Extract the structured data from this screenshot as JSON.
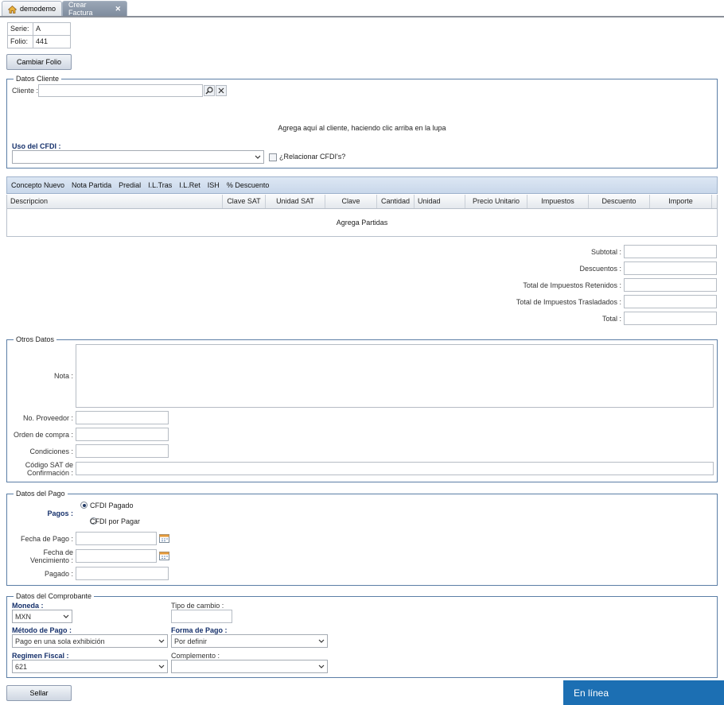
{
  "tabs": [
    {
      "label": "demodemo",
      "icon": "home-icon"
    },
    {
      "label": "Crear Factura",
      "close_icon": "close-icon"
    }
  ],
  "serie_folio": {
    "serie_label": "Serie:",
    "serie_value": "A",
    "folio_label": "Folio:",
    "folio_value": "441"
  },
  "cambiar_folio_label": "Cambiar Folio",
  "datos_cliente": {
    "legend": "Datos Cliente",
    "cliente_label": "Cliente :",
    "cliente_value": "",
    "hint": "Agrega aquí al cliente, haciendo clic arriba en la lupa",
    "uso_cfdi_label": "Uso del CFDI :",
    "uso_cfdi_value": "",
    "relacionar_label": "¿Relacionar CFDI's?"
  },
  "grid": {
    "toolbar": [
      "Concepto Nuevo",
      "Nota Partida",
      "Predial",
      "I.L.Tras",
      "I.L.Ret",
      "ISH",
      "% Descuento"
    ],
    "columns": [
      "Descripcion",
      "Clave SAT",
      "Unidad SAT",
      "Clave",
      "Cantidad",
      "Unidad",
      "Precio Unitario",
      "Impuestos",
      "Descuento",
      "Importe"
    ],
    "empty_text": "Agrega Partidas"
  },
  "totals": {
    "subtotal": "Subtotal :",
    "descuentos": "Descuentos :",
    "retenidos": "Total de Impuestos Retenidos :",
    "trasladados": "Total de Impuestos Trasladados :",
    "total": "Total :"
  },
  "otros_datos": {
    "legend": "Otros Datos",
    "nota": "Nota :",
    "proveedor": "No. Proveedor :",
    "orden": "Orden de compra :",
    "condiciones": "Condiciones :",
    "codigo_sat_1": "Código SAT de",
    "codigo_sat_2": "Confirmación :"
  },
  "datos_pago": {
    "legend": "Datos del Pago",
    "pagos_label": "Pagos :",
    "opt_pagado": "CFDI Pagado",
    "opt_por_pagar": "CFDI por Pagar",
    "selected": "CFDI Pagado",
    "fecha_pago": "Fecha de Pago :",
    "fecha_venc_1": "Fecha de",
    "fecha_venc_2": "Vencimiento :",
    "pagado": "Pagado :"
  },
  "comprobante": {
    "legend": "Datos del Comprobante",
    "moneda_label": "Moneda :",
    "moneda_value": "MXN",
    "tipo_cambio_label": "Tipo de cambio :",
    "metodo_label": "Método de Pago :",
    "metodo_value": "Pago en una sola exhibición",
    "forma_label": "Forma de Pago :",
    "forma_value": "Por definir",
    "regimen_label": "Regimen Fiscal :",
    "regimen_value": "621",
    "complemento_label": "Complemento :",
    "complemento_value": ""
  },
  "sellar_label": "Sellar",
  "status_text": "En línea"
}
